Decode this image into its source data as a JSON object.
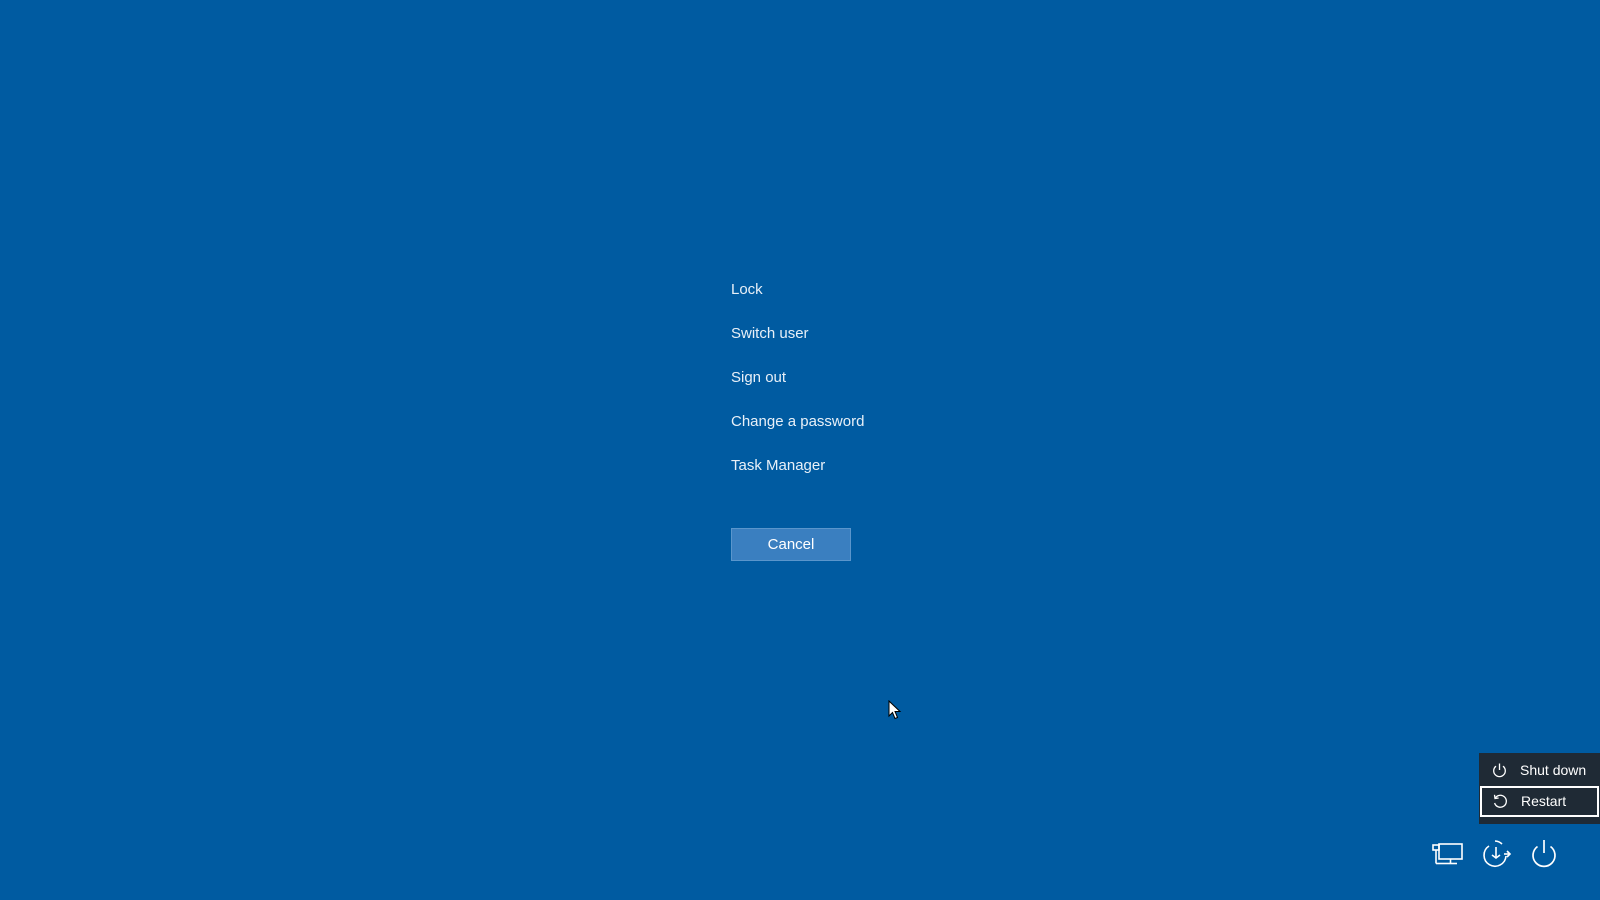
{
  "screen": {
    "background_color": "#005ba1"
  },
  "menu": {
    "items": [
      {
        "label": "Lock"
      },
      {
        "label": "Switch user"
      },
      {
        "label": "Sign out"
      },
      {
        "label": "Change a password"
      },
      {
        "label": "Task Manager"
      }
    ],
    "cancel_label": "Cancel"
  },
  "power_menu": {
    "items": [
      {
        "label": "Shut down",
        "icon": "power-icon"
      },
      {
        "label": "Restart",
        "icon": "restart-icon",
        "selected": true
      }
    ]
  },
  "tray": {
    "icons": [
      "network-icon",
      "accessibility-icon",
      "power-icon"
    ]
  }
}
